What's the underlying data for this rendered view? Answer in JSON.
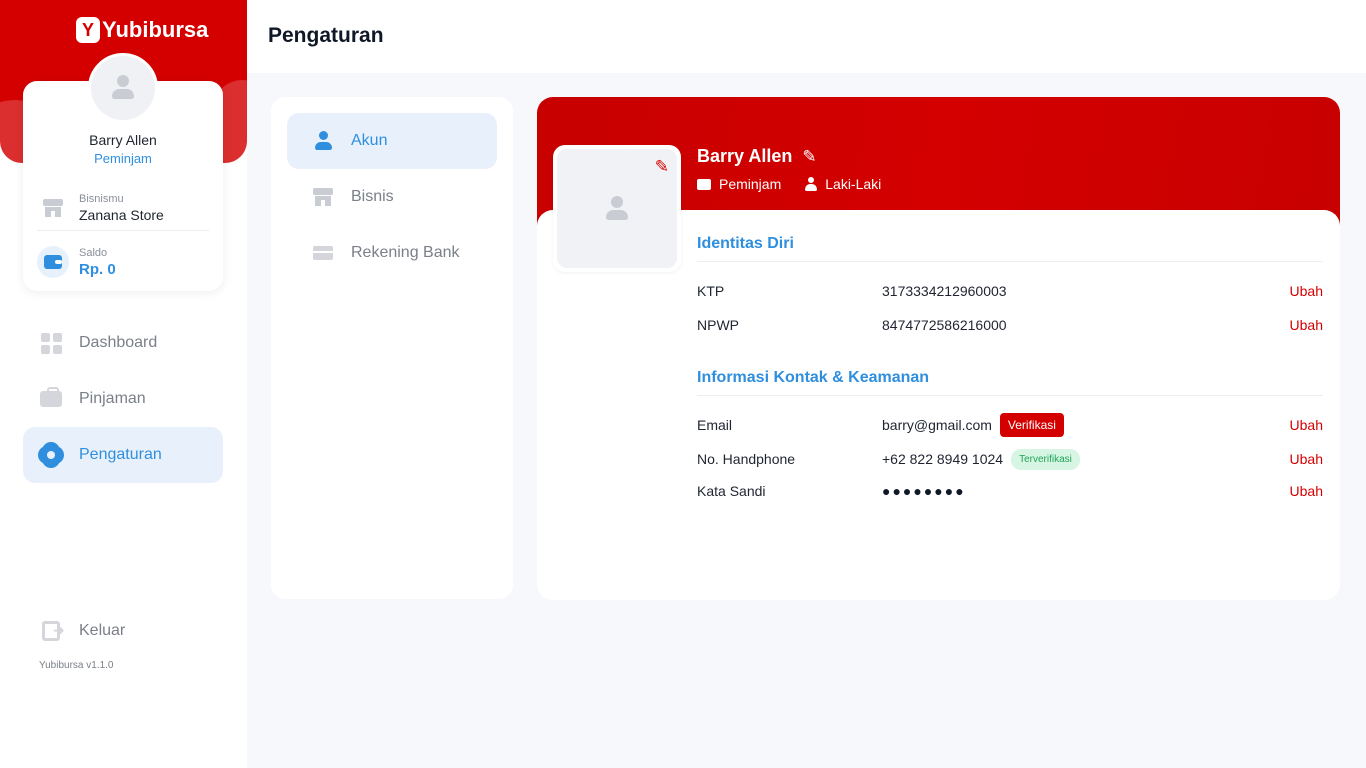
{
  "app": {
    "brand": "Yubibursa",
    "brand_mark": "Y",
    "version": "Yubibursa v1.1.0",
    "colors": {
      "primary": "#d40000",
      "accent": "#2f8fde",
      "success": "#22a35a"
    }
  },
  "sidebar": {
    "profile": {
      "name": "Barry Allen",
      "role": "Peminjam",
      "business_label": "Bisnismu",
      "business_value": "Zanana Store",
      "balance_label": "Saldo",
      "balance_value": "Rp. 0"
    },
    "nav": [
      {
        "label": "Dashboard",
        "icon": "dashboard-icon"
      },
      {
        "label": "Pinjaman",
        "icon": "briefcase-icon"
      },
      {
        "label": "Pengaturan",
        "icon": "gear-icon",
        "active": true
      }
    ],
    "logout_label": "Keluar"
  },
  "header": {
    "title": "Pengaturan"
  },
  "settings_menu": [
    {
      "label": "Akun",
      "icon": "user-icon",
      "active": true
    },
    {
      "label": "Bisnis",
      "icon": "store-icon"
    },
    {
      "label": "Rekening Bank",
      "icon": "bank-card-icon"
    }
  ],
  "account": {
    "name": "Barry Allen",
    "role": "Peminjam",
    "gender": "Laki-Laki",
    "identity": {
      "title": "Identitas Diri",
      "ktp_label": "KTP",
      "ktp_value": "3173334212960003",
      "npwp_label": "NPWP",
      "npwp_value": "8474772586216000"
    },
    "contact": {
      "title": "Informasi Kontak  & Keamanan",
      "email_label": "Email",
      "email_value": "barry@gmail.com",
      "email_badge": "Verifikasi",
      "phone_label": "No. Handphone",
      "phone_value": "+62 822 8949 1024",
      "phone_badge": "Terverifikasi",
      "password_label": "Kata Sandi",
      "password_value": "●●●●●●●●"
    },
    "edit_label": "Ubah"
  }
}
